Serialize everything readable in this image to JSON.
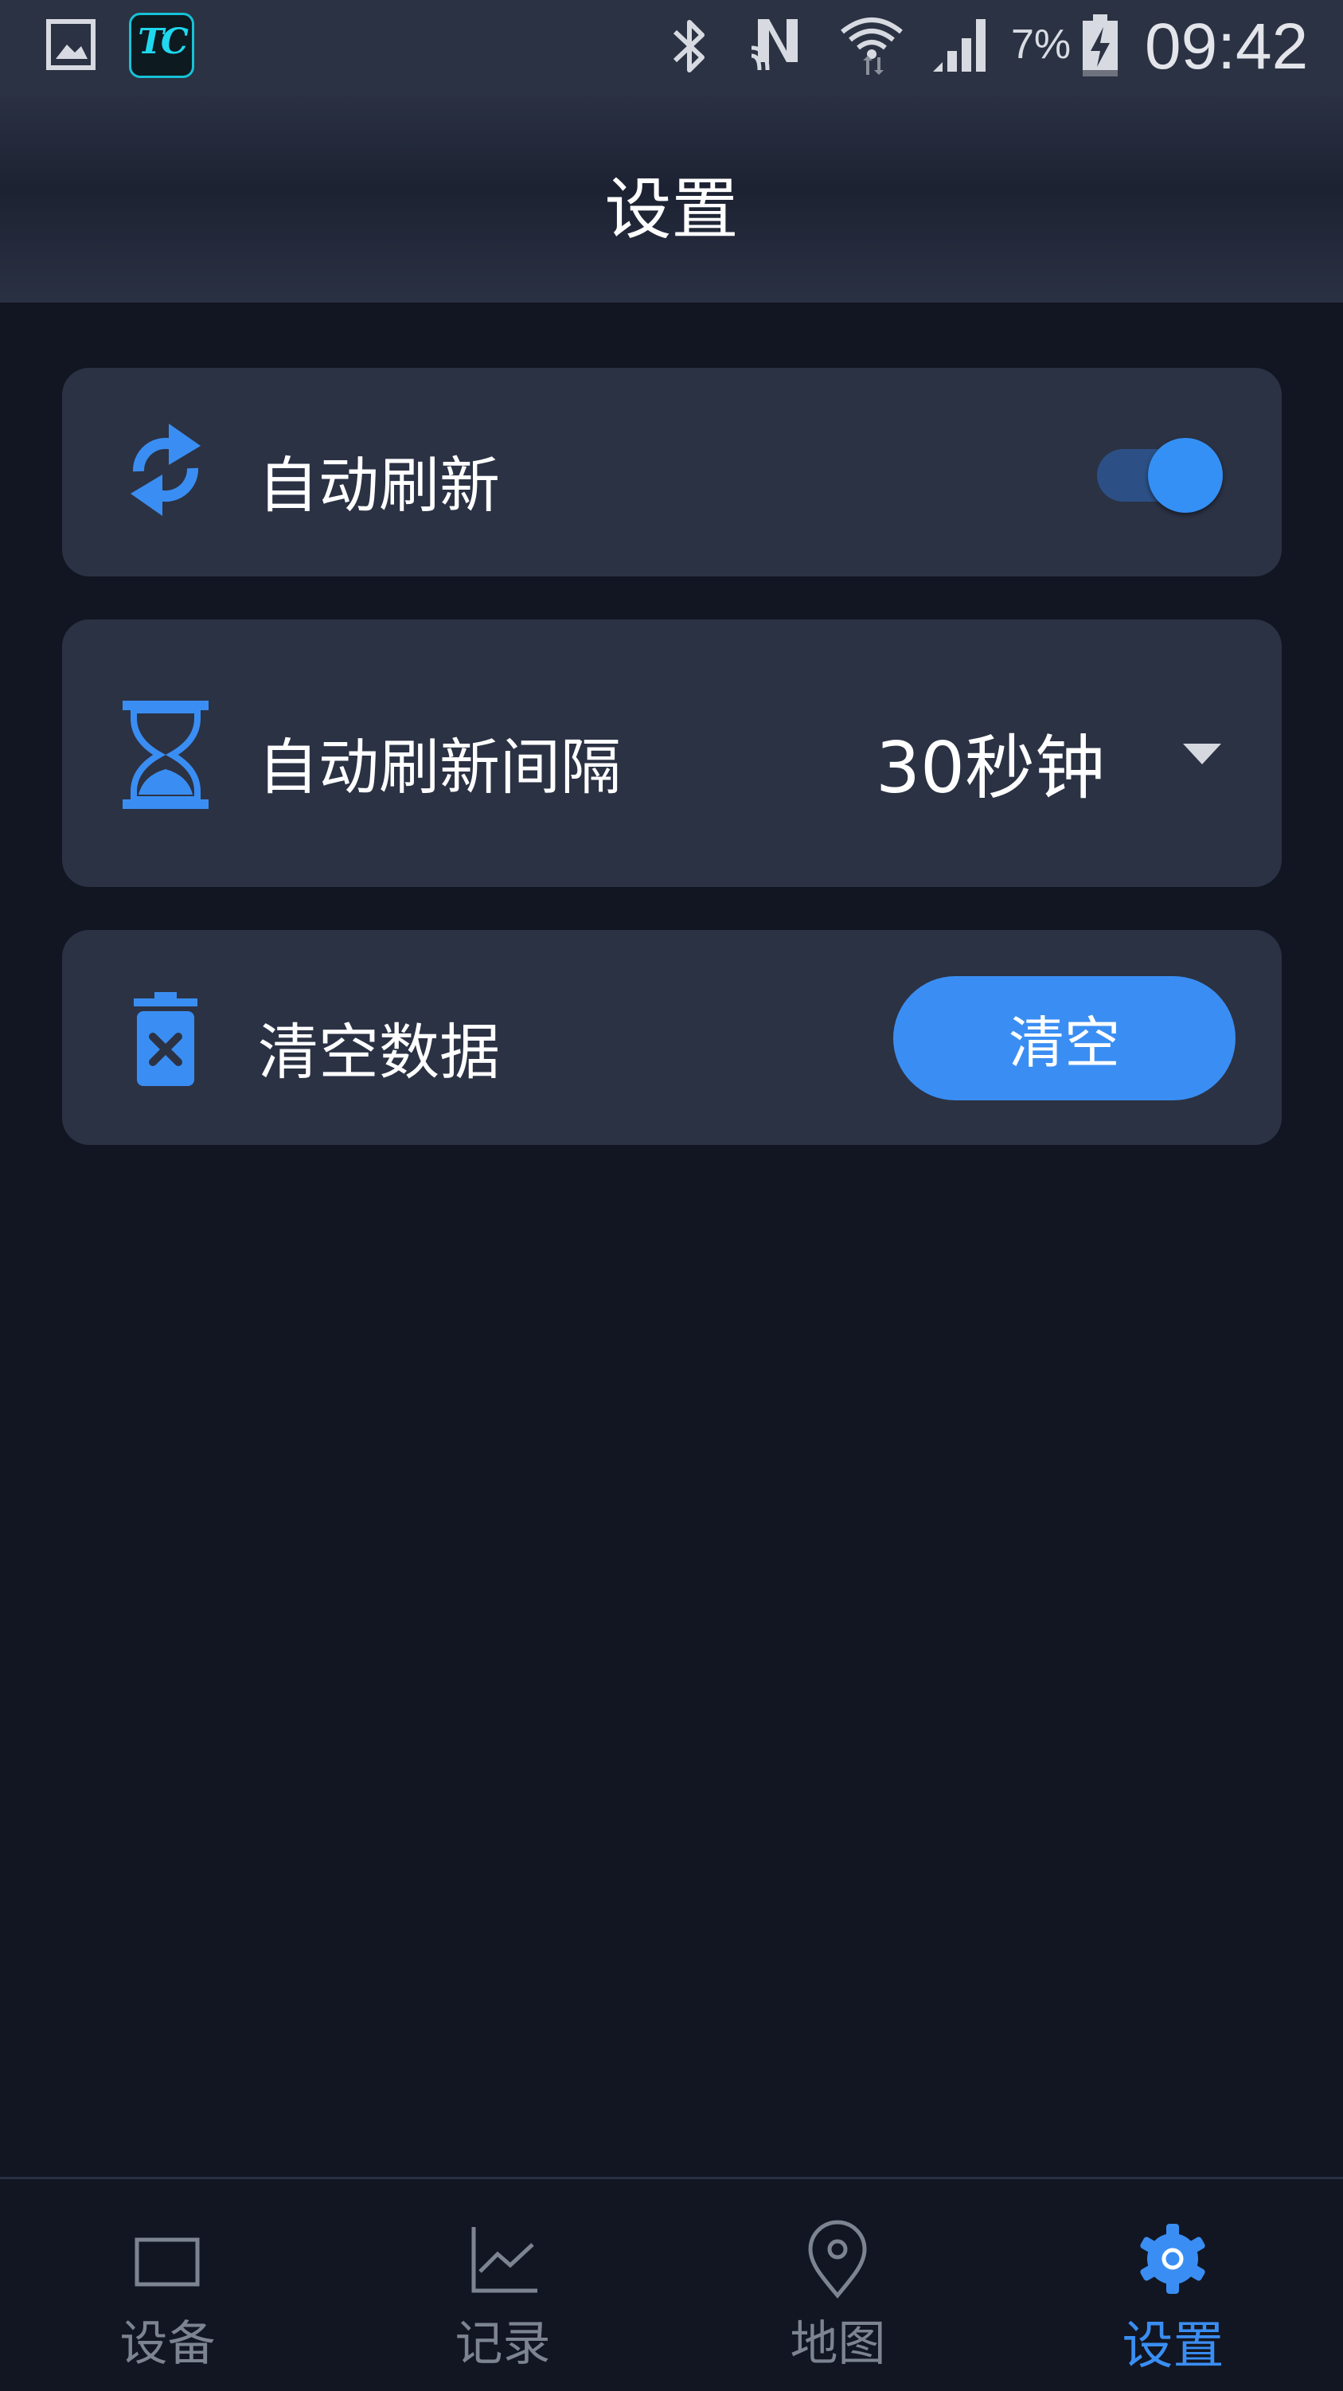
{
  "status_bar": {
    "app_icon_text": "TC",
    "battery_percent": "7%",
    "time": "09:42"
  },
  "header": {
    "title": "设置"
  },
  "settings": {
    "auto_refresh": {
      "label": "自动刷新",
      "enabled": true
    },
    "refresh_interval": {
      "label": "自动刷新间隔",
      "value": "30秒钟"
    },
    "clear_data": {
      "label": "清空数据",
      "button_label": "清空"
    }
  },
  "bottom_nav": {
    "items": [
      {
        "label": "设备",
        "icon": "device-icon",
        "active": false
      },
      {
        "label": "记录",
        "icon": "chart-line-icon",
        "active": false
      },
      {
        "label": "地图",
        "icon": "map-pin-icon",
        "active": false
      },
      {
        "label": "设置",
        "icon": "gear-icon",
        "active": true
      }
    ]
  },
  "colors": {
    "accent": "#3a8ef3",
    "background": "#121622",
    "card": "#2b3244",
    "inactive_nav": "#7d8491"
  }
}
